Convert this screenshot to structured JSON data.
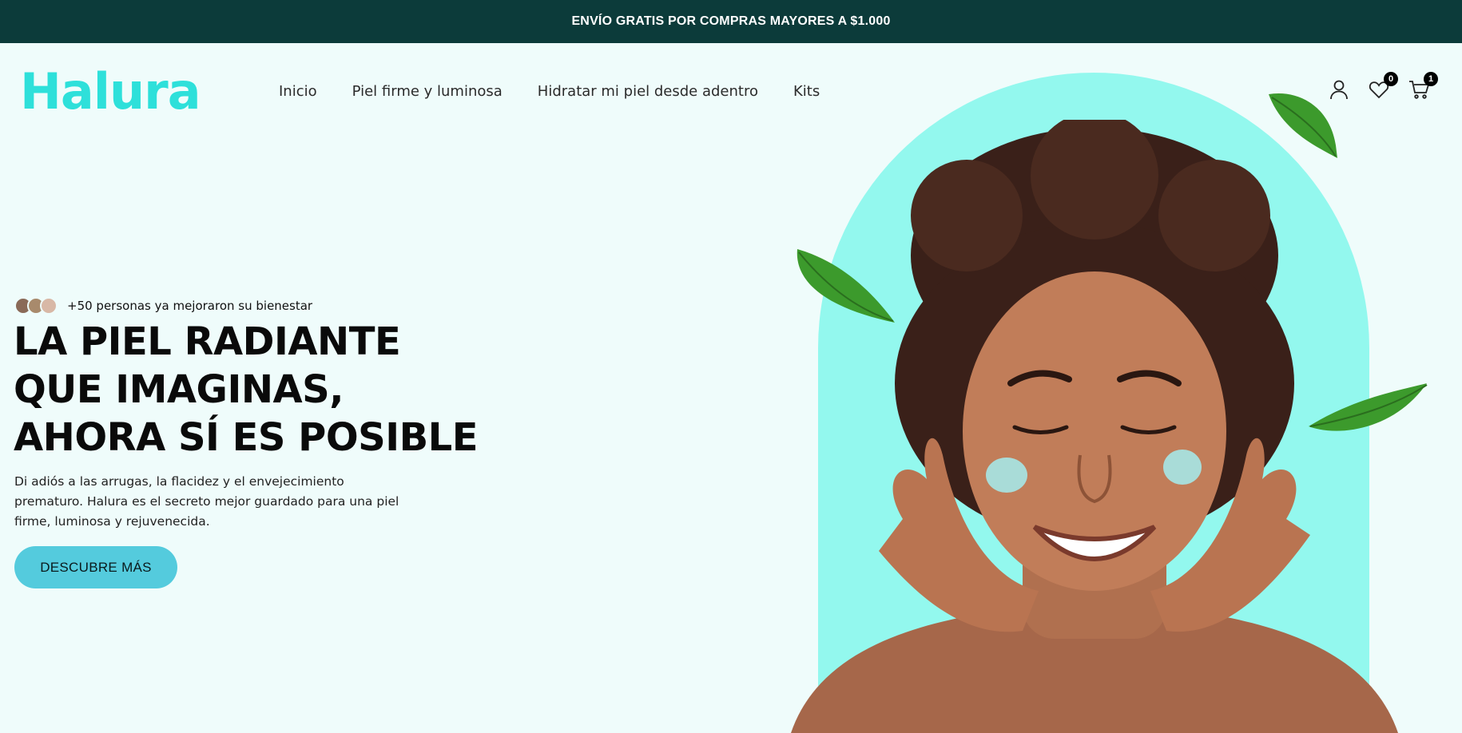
{
  "announcement": "ENVÍO GRATIS POR COMPRAS MAYORES A $1.000",
  "brand": {
    "logo": "Halura",
    "color": "#2ee0da"
  },
  "nav": [
    {
      "label": "Inicio"
    },
    {
      "label": "Piel firme y luminosa"
    },
    {
      "label": "Hidratar mi piel desde adentro"
    },
    {
      "label": "Kits"
    }
  ],
  "header_icons": {
    "account": "user-icon",
    "wishlist": {
      "icon": "heart-icon",
      "count": "0"
    },
    "cart": {
      "icon": "cart-icon",
      "count": "1"
    }
  },
  "hero": {
    "social_proof": "+50 personas ya mejoraron su bienestar",
    "headline_lines": [
      "LA PIEL RADIANTE",
      "QUE IMAGINAS,",
      "AHORA SÍ ES POSIBLE"
    ],
    "description": "Di adiós a las arrugas, la flacidez y el envejecimiento prematuro. Halura es el secreto mejor guardado para una piel firme, luminosa y rejuvenecida.",
    "cta_label": "DESCUBRE MÁS"
  },
  "colors": {
    "announcement_bg": "#0c3b3a",
    "page_bg": "#effcfb",
    "arch": "#93f8ee",
    "cta": "#54cbdd"
  }
}
